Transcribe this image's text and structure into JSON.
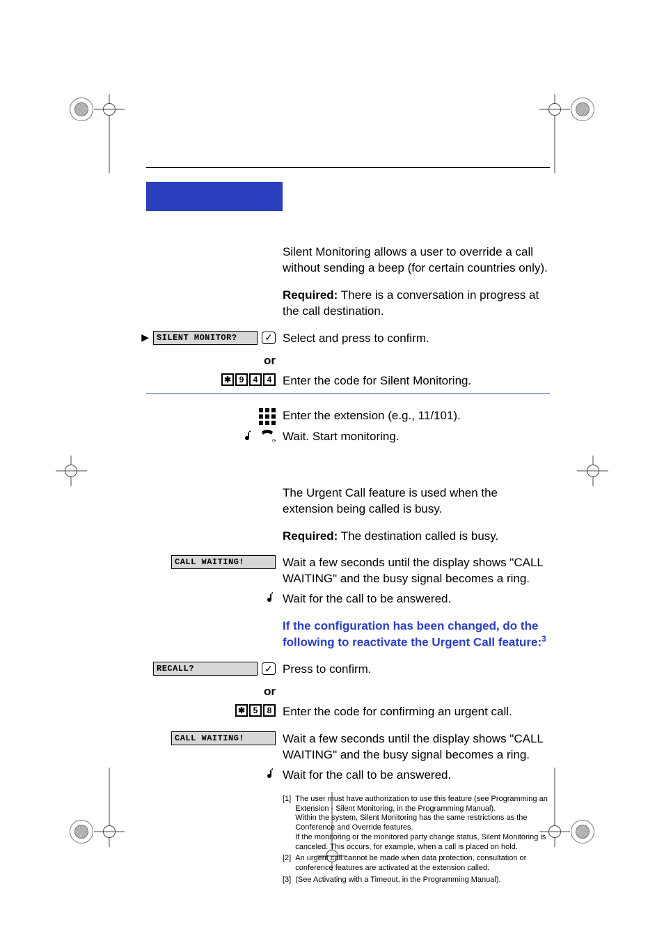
{
  "header_rule": true,
  "sections": {
    "silent_monitoring": {
      "intro": "Silent Monitoring allows a user to override a call without sending a beep (for certain countries only).",
      "required_label": "Required:",
      "required_text": " There is a conversation in progress at the call destination.",
      "lcd_prompt": "SILENT MONITOR?",
      "select_confirm": "Select and press to confirm.",
      "or_label": "or",
      "code_keys": [
        "✱",
        "9",
        "4",
        "4"
      ],
      "code_text": "Enter the code for Silent Monitoring.",
      "enter_ext": "Enter the extension (e.g., 11/101).",
      "wait_start": "Wait. Start monitoring."
    },
    "urgent_call": {
      "intro": "The Urgent Call feature is used when the extension being called is busy.",
      "required_label": "Required:",
      "required_text": " The destination called is busy.",
      "lcd_waiting": "CALL WAITING!",
      "wait_display": "Wait a few seconds until the display shows \"CALL WAITING\" and the busy signal becomes a ring.",
      "wait_answered": "Wait for the call to be answered.",
      "config_changed_heading": "If the configuration has been changed, do the following to reactivate the Urgent Call feature:",
      "config_changed_sup": "3",
      "lcd_recall": "RECALL?",
      "press_confirm": "Press to confirm.",
      "or_label": "or",
      "code_keys": [
        "✱",
        "5",
        "8"
      ],
      "code_text": "Enter the code for confirming an urgent call.",
      "lcd_waiting2": "CALL WAITING!",
      "wait_display2": "Wait a few seconds until the display shows \"CALL WAITING\" and the busy signal becomes a ring.",
      "wait_answered2": "Wait for the call to be answered."
    }
  },
  "footnotes": [
    {
      "idx": "[1]",
      "text": "The user must have authorization to use this feature (see Programming an Extension - Silent Monitoring, in the Programming Manual).\nWithin the system, Silent Monitoring has the same restrictions as the Conference and Override features.\nIf the monitoring or the monitored party change status, Silent Monitoring is canceled. This occurs, for example, when a call is placed on hold."
    },
    {
      "idx": "[2]",
      "text": "An urgent call cannot be made when data protection, consultation or conference features are activated at the extension called."
    },
    {
      "idx": "[3]",
      "text": "(See Activating with a Timeout, in the Programming Manual)."
    }
  ]
}
